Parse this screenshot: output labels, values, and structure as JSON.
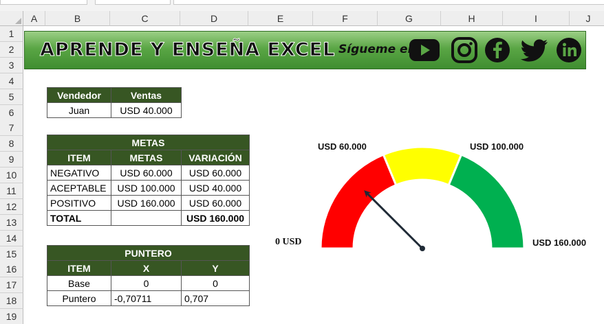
{
  "columns": [
    "A",
    "B",
    "C",
    "D",
    "E",
    "F",
    "G",
    "H",
    "I",
    "J"
  ],
  "rows": [
    "1",
    "2",
    "3",
    "4",
    "5",
    "6",
    "7",
    "8",
    "9",
    "10",
    "11",
    "12",
    "13",
    "14",
    "15",
    "16",
    "17",
    "18",
    "19"
  ],
  "banner": {
    "title": "APRENDE Y ENSEÑA EXCEL",
    "follow": "Sígueme en",
    "social": [
      "youtube-icon",
      "instagram-icon",
      "facebook-icon",
      "twitter-icon",
      "linkedin-icon"
    ]
  },
  "sales_table": {
    "headers": [
      "Vendedor",
      "Ventas"
    ],
    "row": [
      "Juan",
      "USD 40.000"
    ]
  },
  "metas_table": {
    "title": "METAS",
    "headers": [
      "ITEM",
      "METAS",
      "VARIACIÓN"
    ],
    "rows": [
      [
        "NEGATIVO",
        "USD 60.000",
        "USD 60.000"
      ],
      [
        "ACEPTABLE",
        "USD 100.000",
        "USD 40.000"
      ],
      [
        "POSITIVO",
        "USD 160.000",
        "USD 60.000"
      ]
    ],
    "total": [
      "TOTAL",
      "",
      "USD 160.000"
    ]
  },
  "puntero_table": {
    "title": "PUNTERO",
    "headers": [
      "ITEM",
      "X",
      "Y"
    ],
    "rows": [
      [
        "Base",
        "0",
        "0"
      ],
      [
        "Puntero",
        "-0,70711",
        "0,707"
      ]
    ]
  },
  "chart_data": {
    "type": "gauge",
    "min_label": "0 USD",
    "max_label": "USD 160.000",
    "segment_labels": [
      "USD 60.000",
      "USD 100.000"
    ],
    "segments": [
      {
        "name": "NEGATIVO",
        "value": 60000,
        "color": "#ff0000"
      },
      {
        "name": "ACEPTABLE",
        "value": 40000,
        "color": "#ffff00"
      },
      {
        "name": "POSITIVO",
        "value": 60000,
        "color": "#00b050"
      }
    ],
    "total": 160000,
    "pointer": {
      "x": -0.70711,
      "y": 0.707,
      "value": 40000
    },
    "pointer_color": "#1f2a36"
  },
  "colors": {
    "header_green": "#375623",
    "banner_green": "#5aa645"
  }
}
